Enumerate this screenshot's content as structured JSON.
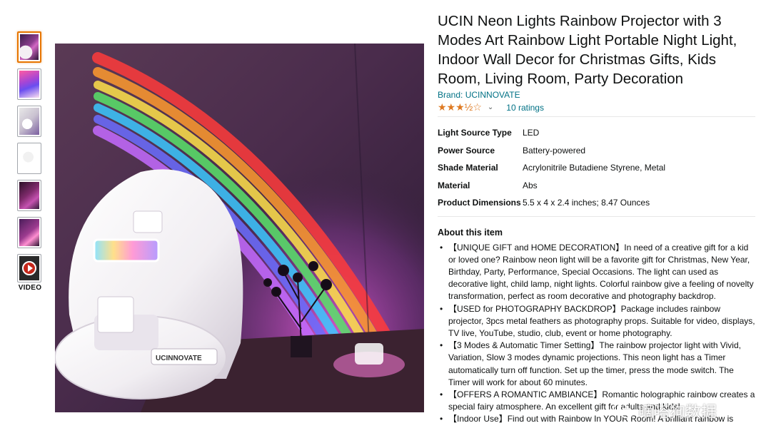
{
  "thumbnails": [
    {
      "name": "thumb-1",
      "active": true
    },
    {
      "name": "thumb-2",
      "active": false
    },
    {
      "name": "thumb-3",
      "active": false
    },
    {
      "name": "thumb-4",
      "active": false
    },
    {
      "name": "thumb-5",
      "active": false
    },
    {
      "name": "thumb-6",
      "active": false
    }
  ],
  "video": {
    "label": "VIDEO",
    "icon": "play-icon"
  },
  "main_image": {
    "logo_text": "UCINNOVATE"
  },
  "product": {
    "title": "UCIN Neon Lights Rainbow Projector with 3 Modes Art Rainbow Light Portable Night Light, Indoor Wall Decor for Christmas Gifts, Kids Room, Living Room, Party Decoration",
    "brand": "Brand: UCINNOVATE",
    "stars": "★★★½☆",
    "rating_value": 3.5,
    "ratings_count": "10 ratings"
  },
  "specs": [
    {
      "key": "Light Source Type",
      "value": "LED"
    },
    {
      "key": "Power Source",
      "value": "Battery-powered"
    },
    {
      "key": "Shade Material",
      "value": "Acrylonitrile Butadiene Styrene, Metal"
    },
    {
      "key": "Material",
      "value": "Abs"
    },
    {
      "key": "Product Dimensions",
      "value": "5.5 x 4 x 2.4 inches; 8.47 Ounces"
    }
  ],
  "about": {
    "title": "About this item",
    "bullets": [
      "【UNIQUE GIFT and HOME DECORATION】In need of a creative gift for a kid or loved one? Rainbow neon light will be a favorite gift for Christmas, New Year, Birthday, Party, Performance, Special Occasions. The light can used as decorative light, child lamp, night lights. Colorful rainbow give a feeling of novelty transformation, perfect as room decorative and photography backdrop.",
      "【USED for PHOTOGRAPHY BACKDROP】Package includes rainbow projector, 3pcs metal feathers as photography props. Suitable for video, displays, TV live, YouTube, studio, club, event or home photography.",
      "【3 Modes & Automatic Timer Setting】The rainbow projector light with Vivid, Variation, Slow 3 modes dynamic projections. This neon light has a Timer automatically turn off function. Set up the timer, press the mode switch. The Timer will work for about 60 minutes.",
      "【OFFERS A ROMANTIC AMBIANCE】Romantic holographic rainbow creates a special fairy atmosphere. An excellent gift for adults and kids!",
      "【Indoor Use】Find out with Rainbow In YOUR Room! A brilliant rainbow is"
    ]
  },
  "watermark": {
    "text": "嘀嗒狗数据"
  },
  "colors": {
    "accent": "#e77600",
    "link": "#007185",
    "star": "#de7921"
  }
}
